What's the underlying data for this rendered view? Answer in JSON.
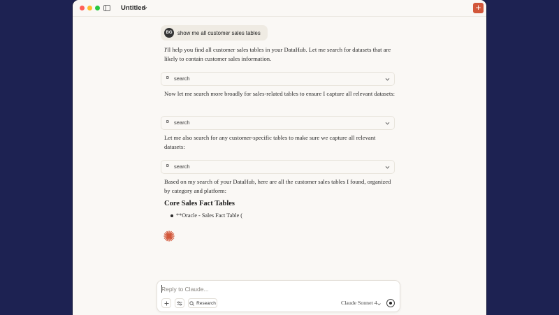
{
  "window": {
    "title": "Untitled",
    "new_chat_label": "+"
  },
  "conversation": {
    "user_message": {
      "avatar_initials": "BG",
      "text": "show me all customer sales tables"
    },
    "assistant": {
      "para1": "I'll help you find all customer sales tables in your DataHub. Let me search for datasets that are likely to contain customer sales information.",
      "tool1": {
        "badge": "D",
        "name": "search"
      },
      "para2": "Now let me search more broadly for sales-related tables to ensure I capture all relevant datasets:",
      "tool2": {
        "badge": "D",
        "name": "search"
      },
      "para3": "Let me also search for any customer-specific tables to make sure we capture all relevant datasets:",
      "tool3": {
        "badge": "D",
        "name": "search"
      },
      "para4": "Based on my search of your DataHub, here are all the customer sales tables I found, organized by category and platform:",
      "heading": "Core Sales Fact Tables",
      "bullets": [
        "**Oracle - Sales Fact Table ("
      ]
    }
  },
  "composer": {
    "placeholder": "Reply to Claude...",
    "research_label": "Research",
    "model_label": "Claude Sonnet 4"
  },
  "colors": {
    "desktop_bg": "#1d2252",
    "window_bg": "#faf8f5",
    "accent": "#d2573a"
  }
}
